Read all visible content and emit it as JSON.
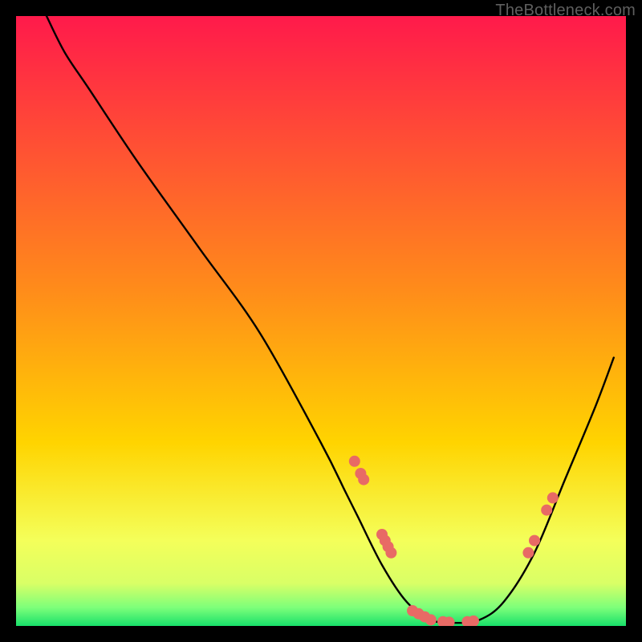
{
  "watermark": "TheBottleneck.com",
  "colors": {
    "top": "#ff1a4b",
    "mid": "#ffd400",
    "bottom_band": "#d9ff66",
    "green": "#18e06a",
    "curve": "#000000",
    "marker": "#e86a65"
  },
  "chart_data": {
    "type": "line",
    "title": "",
    "xlabel": "",
    "ylabel": "",
    "xlim": [
      0,
      100
    ],
    "ylim": [
      0,
      100
    ],
    "grid": false,
    "legend": false,
    "annotations": [],
    "series": [
      {
        "name": "curve",
        "x": [
          5,
          8,
          12,
          20,
          30,
          40,
          50,
          54,
          56,
          60,
          64,
          68,
          72,
          76,
          80,
          85,
          90,
          95,
          98
        ],
        "y": [
          100,
          94,
          88,
          76,
          62,
          48,
          30,
          22,
          18,
          10,
          4,
          1,
          0.5,
          1,
          4,
          12,
          24,
          36,
          44
        ]
      }
    ],
    "markers": [
      {
        "x": 55.5,
        "y": 27
      },
      {
        "x": 56.5,
        "y": 25
      },
      {
        "x": 57,
        "y": 24
      },
      {
        "x": 60,
        "y": 15
      },
      {
        "x": 60.5,
        "y": 14
      },
      {
        "x": 61,
        "y": 13
      },
      {
        "x": 61.5,
        "y": 12
      },
      {
        "x": 65,
        "y": 2.5
      },
      {
        "x": 66,
        "y": 2
      },
      {
        "x": 67,
        "y": 1.5
      },
      {
        "x": 68,
        "y": 1
      },
      {
        "x": 70,
        "y": 0.7
      },
      {
        "x": 71,
        "y": 0.6
      },
      {
        "x": 74,
        "y": 0.7
      },
      {
        "x": 75,
        "y": 0.8
      },
      {
        "x": 84,
        "y": 12
      },
      {
        "x": 85,
        "y": 14
      },
      {
        "x": 87,
        "y": 19
      },
      {
        "x": 88,
        "y": 21
      }
    ]
  }
}
